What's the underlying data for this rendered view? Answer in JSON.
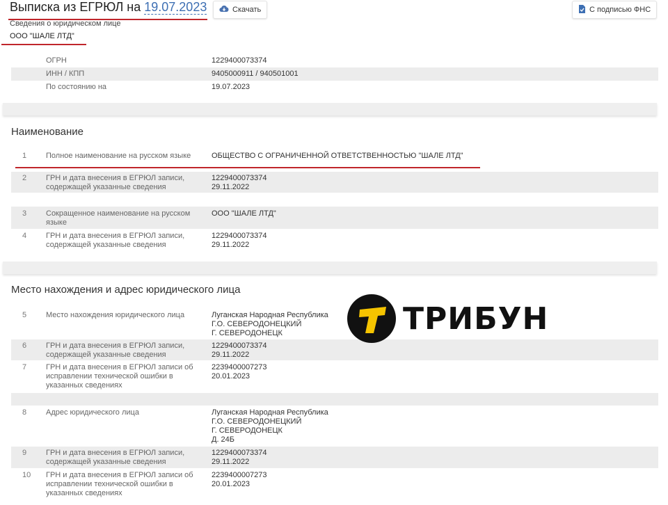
{
  "header": {
    "title_prefix": "Выписка из ЕГРЮЛ на ",
    "title_date": "19.07.2023",
    "download_label": "Скачать",
    "fns_label": "С подписью ФНС",
    "subtitle": "Сведения о юридическом лице",
    "org_name": "ООО \"ШАЛЕ ЛТД\""
  },
  "summary": [
    {
      "label": "ОГРН",
      "value": "1229400073374"
    },
    {
      "label": "ИНН / КПП",
      "value": "9405000911 / 940501001"
    },
    {
      "label": "По состоянию на",
      "value": "19.07.2023"
    }
  ],
  "section_name": {
    "title": "Наименование",
    "rows": [
      {
        "n": "1",
        "label": "Полное наименование на русском языке",
        "value": "ОБЩЕСТВО С ОГРАНИЧЕННОЙ ОТВЕТСТВЕННОСТЬЮ \"ШАЛЕ ЛТД\""
      },
      {
        "n": "2",
        "label": "ГРН и дата внесения в ЕГРЮЛ записи, содержащей указанные сведения",
        "value": "1229400073374\n29.11.2022"
      },
      {
        "n": "3",
        "label": "Сокращенное наименование на русском языке",
        "value": "ООО \"ШАЛЕ ЛТД\""
      },
      {
        "n": "4",
        "label": "ГРН и дата внесения в ЕГРЮЛ записи, содержащей указанные сведения",
        "value": "1229400073374\n29.11.2022"
      }
    ]
  },
  "section_address": {
    "title": "Место нахождения и адрес юридического лица",
    "rows": [
      {
        "n": "5",
        "label": "Место нахождения юридического лица",
        "value": "Луганская Народная Республика\nГ.О. СЕВЕРОДОНЕЦКИЙ\nГ. СЕВЕРОДОНЕЦК"
      },
      {
        "n": "6",
        "label": "ГРН и дата внесения в ЕГРЮЛ записи, содержащей указанные сведения",
        "value": "1229400073374\n29.11.2022"
      },
      {
        "n": "7",
        "label": "ГРН и дата внесения в ЕГРЮЛ записи об исправлении технической ошибки в указанных сведениях",
        "value": "2239400007273\n20.01.2023"
      },
      {
        "n": "8",
        "label": "Адрес юридического лица",
        "value": "Луганская Народная Республика\nГ.О. СЕВЕРОДОНЕЦКИЙ\nГ. СЕВЕРОДОНЕЦК\nД. 24Б"
      },
      {
        "n": "9",
        "label": "ГРН и дата внесения в ЕГРЮЛ записи, содержащей указанные сведения",
        "value": "1229400073374\n29.11.2022"
      },
      {
        "n": "10",
        "label": "ГРН и дата внесения в ЕГРЮЛ записи об исправлении технической ошибки в указанных сведениях",
        "value": "2239400007273\n20.01.2023"
      }
    ]
  },
  "watermark": {
    "text": "ТРИБУН",
    "icon": "tribun-logo-icon"
  },
  "colors": {
    "accent_red": "#c0262b",
    "link_blue": "#3d6fb3",
    "row_shade": "#ececec"
  }
}
